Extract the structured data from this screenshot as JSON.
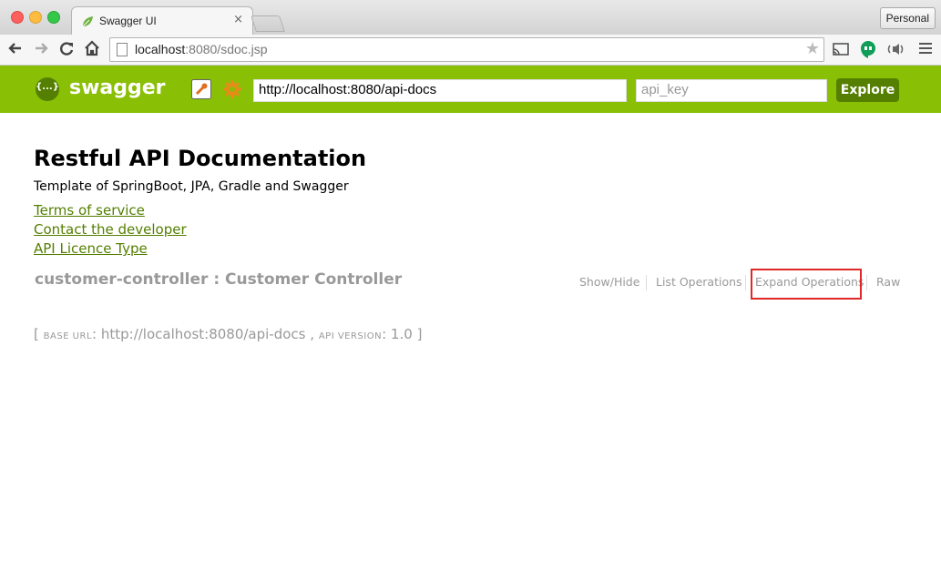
{
  "browser": {
    "tab_title": "Swagger UI",
    "tab_close": "×",
    "profile_label": "Personal",
    "url_host": "localhost",
    "url_rest": ":8080/sdoc.jsp",
    "icons": [
      "back-arrow-icon",
      "forward-arrow-icon",
      "reload-icon",
      "home-icon",
      "page-icon",
      "bookmark-star-icon",
      "cast-icon",
      "hangouts-icon",
      "audio-icon",
      "menu-icon"
    ]
  },
  "swagger": {
    "logo_mark": "{...}",
    "logo_text": "swagger",
    "api_url": "http://localhost:8080/api-docs",
    "api_key_placeholder": "api_key",
    "explore_label": "Explore",
    "colors": {
      "header_bg": "#89bf04",
      "accent": "#547f00"
    }
  },
  "info": {
    "title": "Restful API Documentation",
    "description": "Template of SpringBoot, JPA, Gradle and Swagger",
    "links": [
      "Terms of service",
      "Contact the developer",
      "API Licence Type"
    ]
  },
  "resource": {
    "name": "customer-controller : Customer Controller",
    "operations": [
      "Show/Hide",
      "List Operations",
      "Expand Operations",
      "Raw"
    ],
    "highlighted_operation": "Expand Operations",
    "highlight_color": "#e02828"
  },
  "footer": {
    "open_bracket": "[",
    "base_url_label": "base url",
    "base_url": "http://localhost:8080/api-docs",
    "comma": ",",
    "api_version_label": "api version",
    "api_version": "1.0",
    "close_bracket": "]"
  }
}
